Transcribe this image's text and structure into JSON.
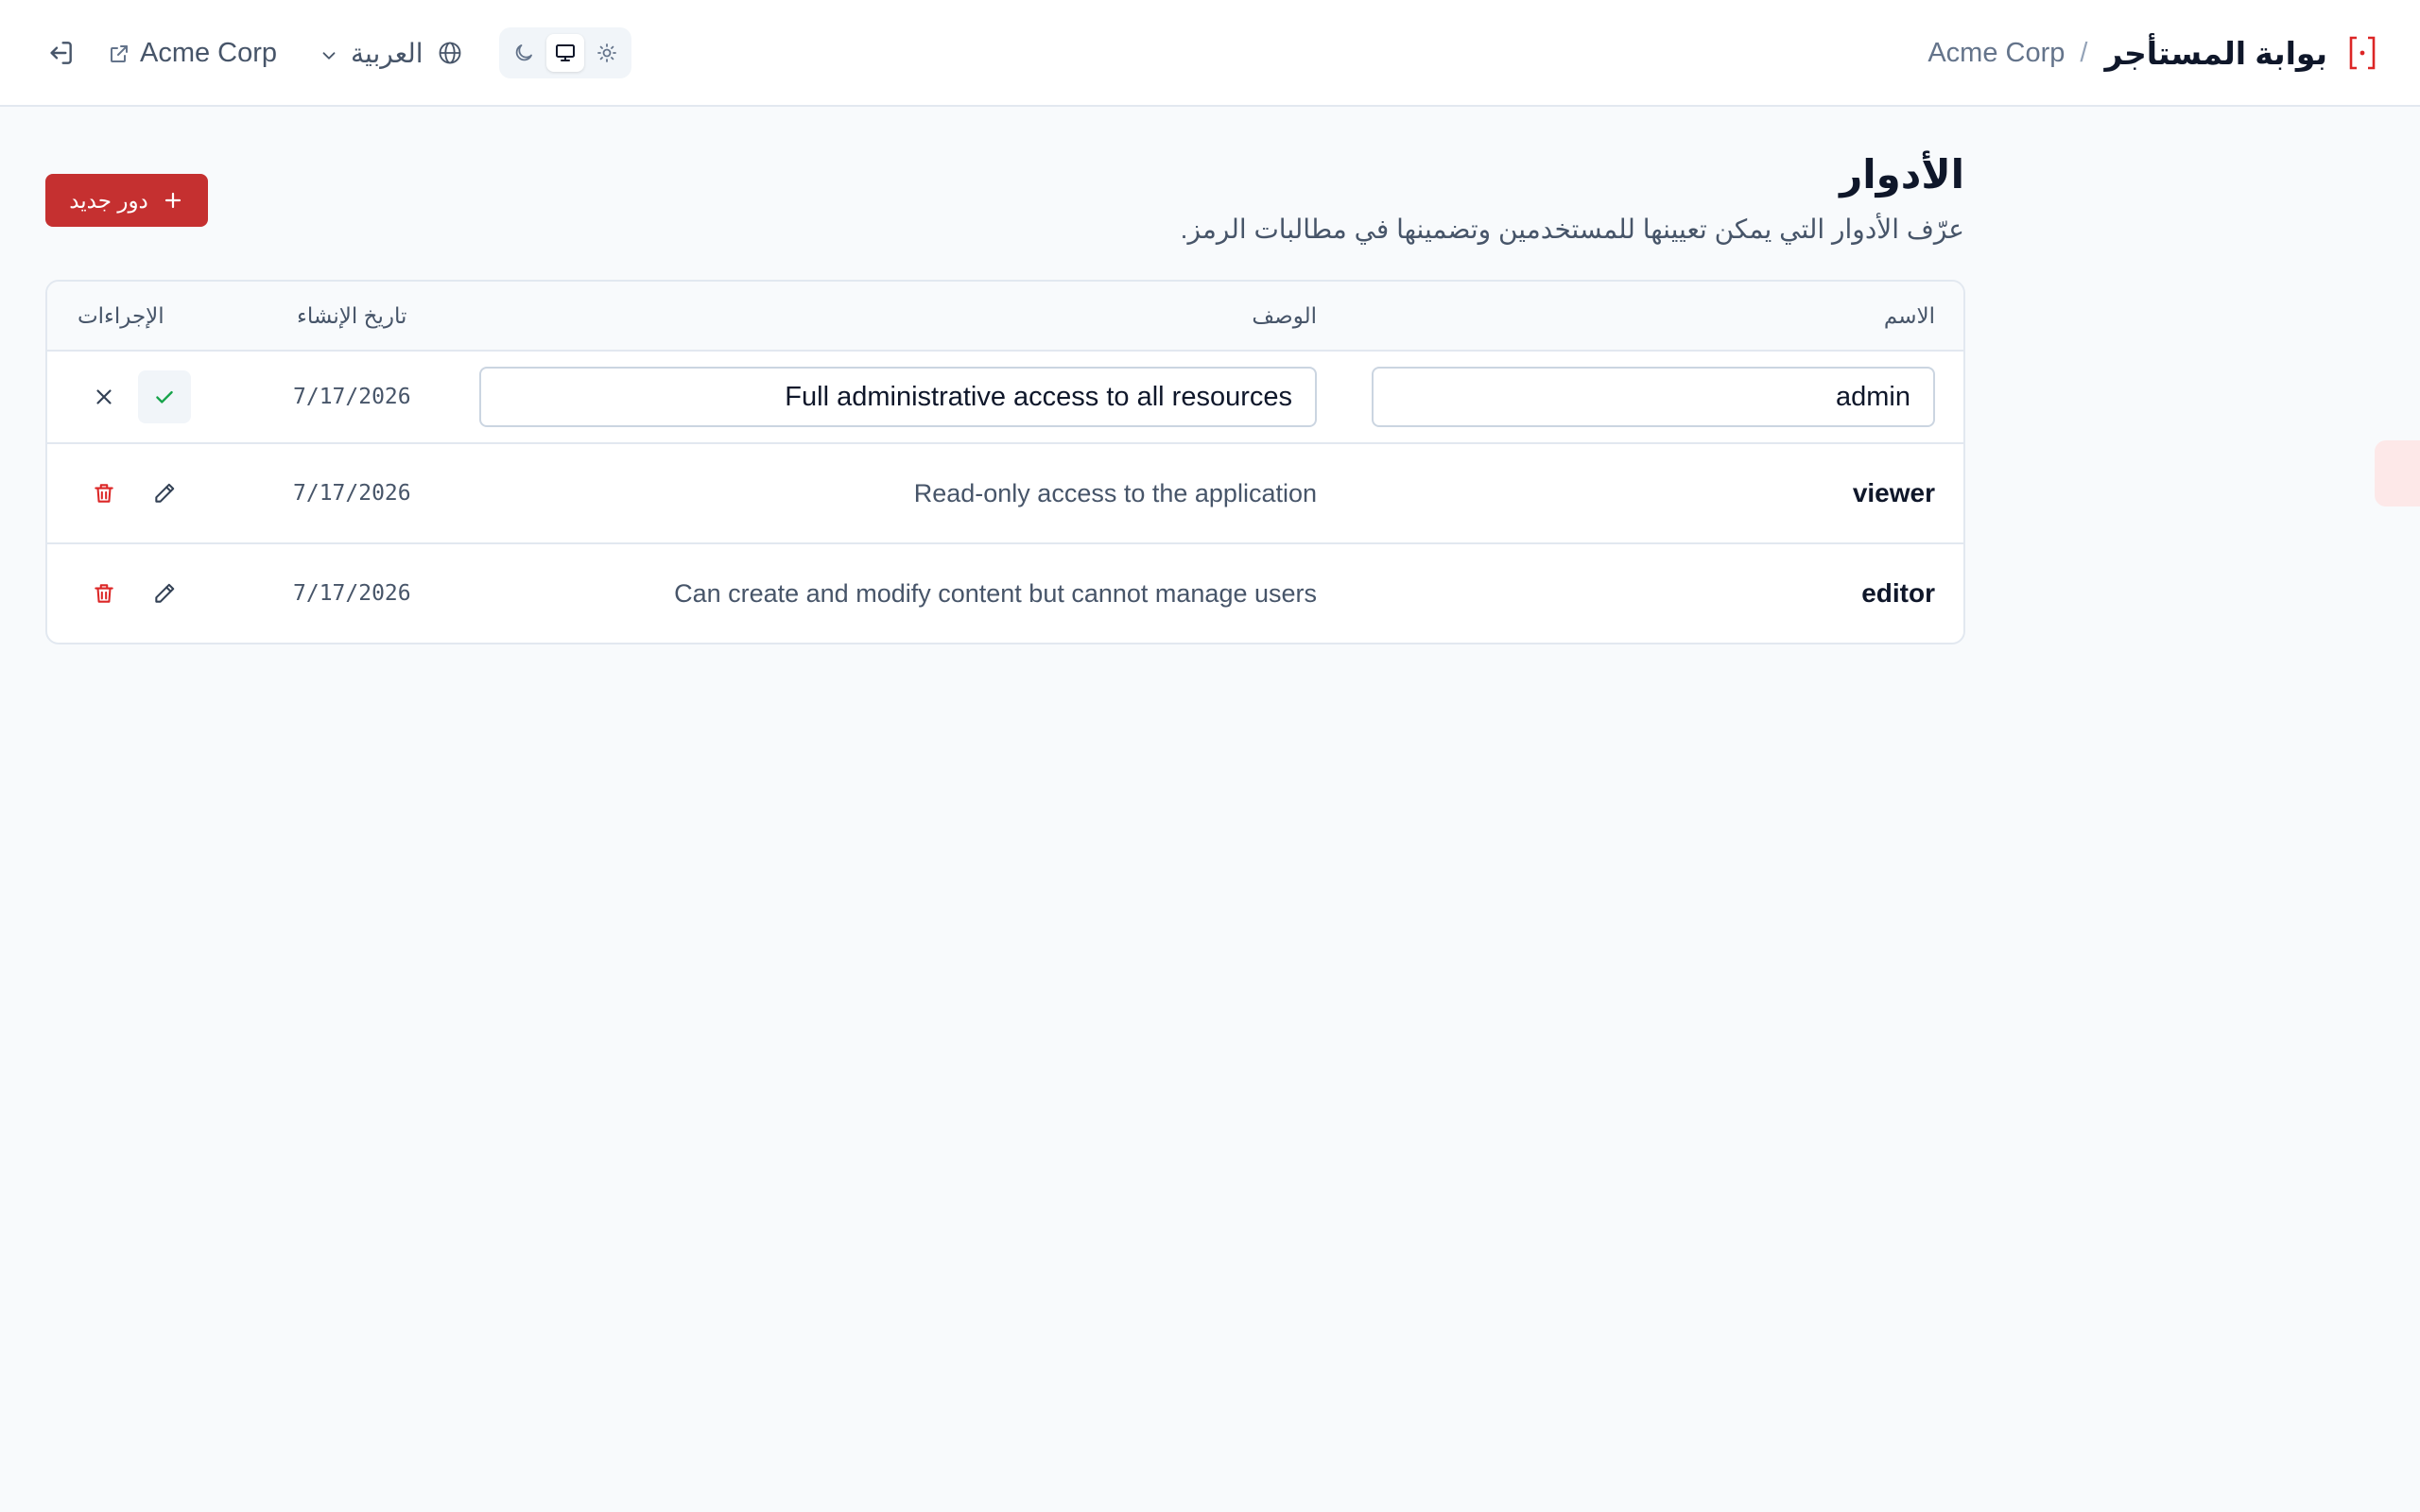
{
  "header": {
    "brand_title": "بوابة المستأجر",
    "breadcrumb_separator": "/",
    "tenant_name": "Acme Corp",
    "tenant_link_label": "Acme Corp",
    "language_label": "العربية",
    "theme_options": [
      "light",
      "system",
      "dark"
    ],
    "theme_selected": "system"
  },
  "page": {
    "title": "الأدوار",
    "subtitle": "عرّف الأدوار التي يمكن تعيينها للمستخدمين وتضمينها في مطالبات الرمز.",
    "new_role_label": "دور جديد"
  },
  "table": {
    "columns": {
      "name": "الاسم",
      "description": "الوصف",
      "created": "تاريخ الإنشاء",
      "actions": "الإجراءات"
    },
    "rows": [
      {
        "name": "admin",
        "description": "Full administrative access to all resources",
        "created": "7/17/2026",
        "editing": true
      },
      {
        "name": "viewer",
        "description": "Read-only access to the application",
        "created": "7/17/2026",
        "editing": false
      },
      {
        "name": "editor",
        "description": "Can create and modify content but cannot manage users",
        "created": "7/17/2026",
        "editing": false
      }
    ]
  },
  "colors": {
    "accent": "#c53030",
    "success": "#16a34a",
    "danger": "#dc2626"
  },
  "icons": {
    "logout": "logout-icon",
    "external_link": "external-link-icon",
    "chevron": "chevron-down-icon",
    "globe": "globe-icon",
    "moon": "moon-icon",
    "monitor": "monitor-icon",
    "sun": "sun-icon",
    "logo": "bracket-logo-icon",
    "plus": "plus-icon",
    "check": "check-icon",
    "close": "close-icon",
    "trash": "trash-icon",
    "pencil": "pencil-icon"
  }
}
